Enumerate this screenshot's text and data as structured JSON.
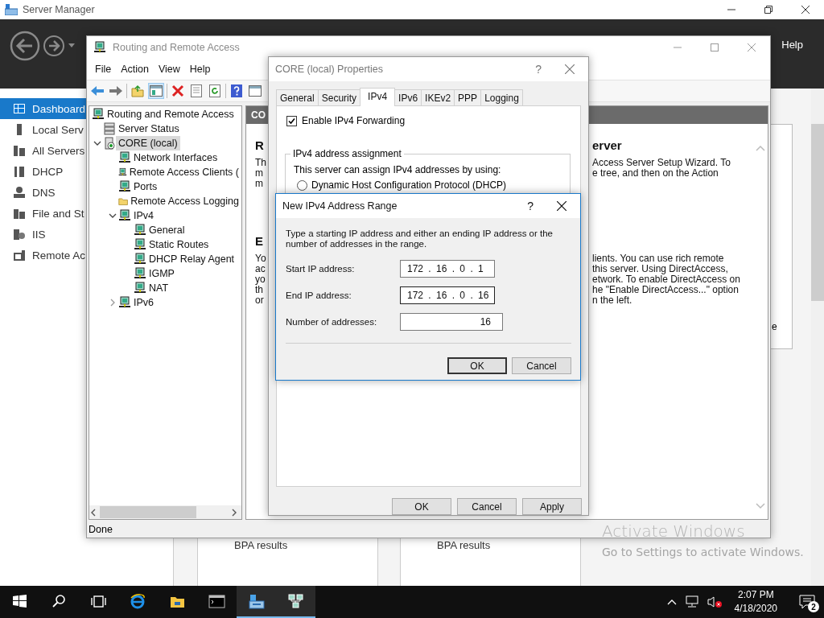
{
  "server_manager": {
    "title": "Server Manager",
    "help": "Help",
    "nav": [
      {
        "label": "Dashboard",
        "kind": "dashboard",
        "selected": true
      },
      {
        "label": "Local Serv",
        "kind": "server",
        "selected": false
      },
      {
        "label": "All Servers",
        "kind": "servers",
        "selected": false
      },
      {
        "label": "DHCP",
        "kind": "dhcp",
        "selected": false
      },
      {
        "label": "DNS",
        "kind": "dns",
        "selected": false
      },
      {
        "label": "File and St",
        "kind": "files",
        "selected": false
      },
      {
        "label": "IIS",
        "kind": "iis",
        "selected": false
      },
      {
        "label": "Remote Ac",
        "kind": "remote",
        "selected": false
      }
    ],
    "edge_text": "e",
    "tiles": [
      {
        "label": "BPA results"
      },
      {
        "label": "BPA results"
      }
    ]
  },
  "rras": {
    "title": "Routing and Remote Access",
    "menu": [
      "File",
      "Action",
      "View",
      "Help"
    ],
    "tree": [
      {
        "label": "Routing and Remote Access",
        "kind": "node",
        "selected": false,
        "children": [
          {
            "label": "Server Status",
            "kind": "status",
            "selected": false
          },
          {
            "label": "CORE (local)",
            "kind": "server",
            "selected": true,
            "expanded": true,
            "children": [
              {
                "label": "Network Interfaces",
                "kind": "node",
                "selected": false
              },
              {
                "label": "Remote Access Clients (",
                "kind": "node",
                "selected": false
              },
              {
                "label": "Ports",
                "kind": "node",
                "selected": false
              },
              {
                "label": "Remote Access Logging",
                "kind": "folder",
                "selected": false
              },
              {
                "label": "IPv4",
                "kind": "node",
                "selected": false,
                "expanded": true,
                "children": [
                  {
                    "label": "General",
                    "kind": "node",
                    "selected": false
                  },
                  {
                    "label": "Static Routes",
                    "kind": "node",
                    "selected": false
                  },
                  {
                    "label": "DHCP Relay Agent",
                    "kind": "node",
                    "selected": false
                  },
                  {
                    "label": "IGMP",
                    "kind": "node",
                    "selected": false
                  },
                  {
                    "label": "NAT",
                    "kind": "node",
                    "selected": false
                  }
                ]
              },
              {
                "label": "IPv6",
                "kind": "node",
                "selected": false,
                "expanded": false
              }
            ]
          }
        ]
      }
    ],
    "pane_header": "CO",
    "sections": [
      {
        "heading_left": "R",
        "heading_right": "erver",
        "lines": [
          {
            "left": "Th",
            "right": "Access Server Setup Wizard. To"
          },
          {
            "left": "m",
            "right": "e tree, and then on the Action"
          },
          {
            "left": "m"
          }
        ]
      },
      {
        "heading_left": "E",
        "lines": [
          {
            "left": "Yo",
            "right": "lients. You can use rich remote"
          },
          {
            "left": "ac",
            "right": "this server. Using DirectAccess,"
          },
          {
            "left": "yo",
            "right": "etwork. To enable DirectAccess on"
          },
          {
            "left": "th",
            "right": "he \"Enable DirectAccess...\" option"
          },
          {
            "left": "or",
            "right": "n the left."
          }
        ]
      }
    ],
    "status": "Done"
  },
  "properties": {
    "title": "CORE (local) Properties",
    "help_glyph": "?",
    "tabs": [
      {
        "label": "General",
        "selected": false
      },
      {
        "label": "Security",
        "selected": false
      },
      {
        "label": "IPv4",
        "selected": true
      },
      {
        "label": "IPv6",
        "selected": false
      },
      {
        "label": "IKEv2",
        "selected": false
      },
      {
        "label": "PPP",
        "selected": false
      },
      {
        "label": "Logging",
        "selected": false
      }
    ],
    "forwarding": {
      "label": "Enable IPv4 Forwarding",
      "checked": true
    },
    "group": {
      "title": "IPv4 address assignment",
      "text": "This server can assign IPv4 addresses by using:",
      "options": [
        {
          "label": "Dynamic Host Configuration Protocol (DHCP)",
          "selected": false
        }
      ]
    },
    "buttons": [
      "OK",
      "Cancel",
      "Apply"
    ]
  },
  "range_dialog": {
    "title": "New IPv4 Address Range",
    "help_glyph": "?",
    "instructions": "Type a starting IP address and either an ending IP address or the number of addresses in the range.",
    "fields": [
      {
        "kind": "ip",
        "label": "Start IP address:",
        "value": "172 . 16 . 0 . 1",
        "focused": false
      },
      {
        "kind": "ip",
        "label": "End IP address:",
        "value": "172 . 16 . 0 . 16",
        "focused": true
      },
      {
        "kind": "number",
        "label": "Number of addresses:",
        "value": "16",
        "focused": false
      }
    ],
    "buttons": [
      {
        "label": "OK",
        "default": true
      },
      {
        "label": "Cancel",
        "default": false
      }
    ]
  },
  "activation": {
    "title": "Activate Windows",
    "subtitle": "Go to Settings to activate Windows."
  },
  "taskbar": {
    "buttons": [
      {
        "kind": "start",
        "active": false
      },
      {
        "kind": "search",
        "active": false
      },
      {
        "kind": "taskview",
        "active": false
      },
      {
        "kind": "browser",
        "active": false
      },
      {
        "kind": "explorer",
        "active": false
      },
      {
        "kind": "console",
        "active": false
      },
      {
        "kind": "servermanager",
        "active": true
      },
      {
        "kind": "network",
        "active": true
      }
    ],
    "time": "2:07 PM",
    "date": "4/18/2020",
    "notifications": "2"
  }
}
